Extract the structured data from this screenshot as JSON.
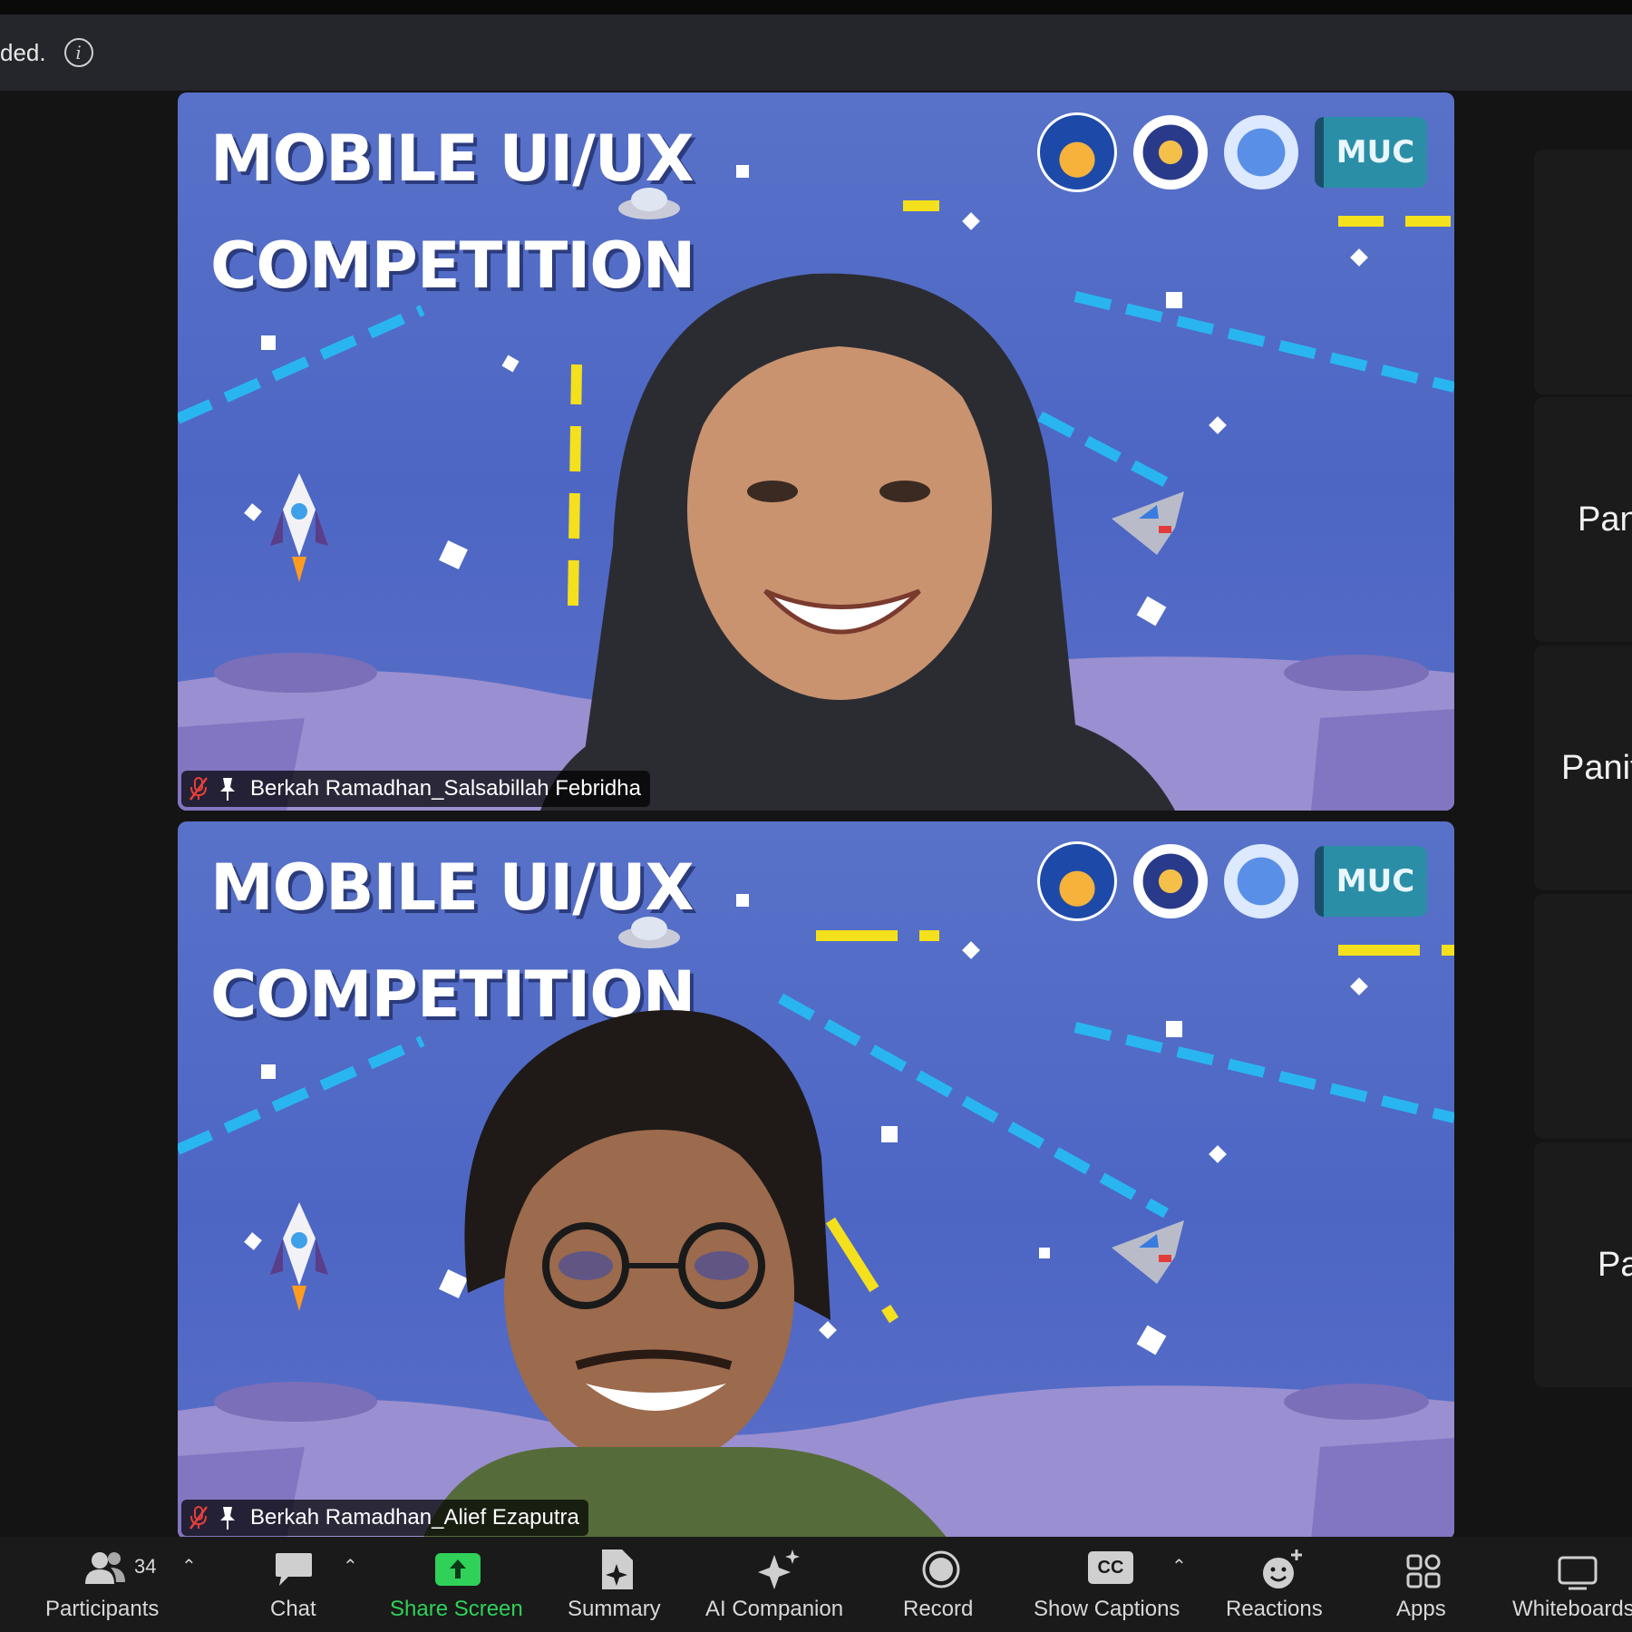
{
  "infobar": {
    "message": "ded."
  },
  "tiles": [
    {
      "title_line1": "MOBILE UI/UX",
      "title_line2": "COMPETITION",
      "logo_text": "MUC",
      "participant_name": "Berkah Ramadhan_Salsabillah Febridha"
    },
    {
      "title_line1": "MOBILE UI/UX",
      "title_line2": "COMPETITION",
      "logo_text": "MUC",
      "participant_name": "Berkah Ramadhan_Alief Ezaputra"
    }
  ],
  "side_panels": [
    "",
    "Pan",
    "Panit",
    "",
    "Pa"
  ],
  "toolbar": {
    "participants_count": "34",
    "participants": "Participants",
    "chat": "Chat",
    "share_screen": "Share Screen",
    "summary": "Summary",
    "ai_companion": "AI Companion",
    "record": "Record",
    "show_captions": "Show Captions",
    "reactions": "Reactions",
    "apps": "Apps",
    "whiteboards": "Whiteboards",
    "captions_badge": "CC"
  },
  "colors": {
    "background": "#111111",
    "toolbar": "#1a1a1a",
    "share_green": "#2fd158",
    "tile_blue": "#5872c9"
  }
}
